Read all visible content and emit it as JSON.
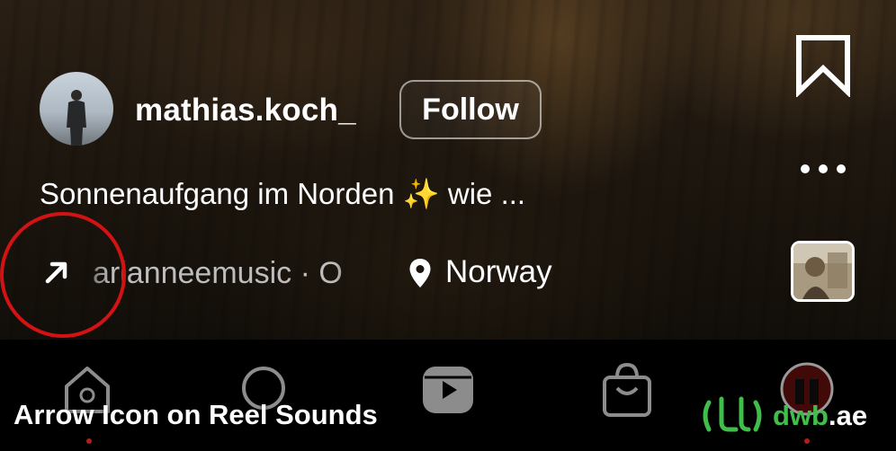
{
  "reel": {
    "username": "mathias.koch_",
    "follow_label": "Follow",
    "caption": "Sonnenaufgang im Norden",
    "caption_sparkle": "✨",
    "caption_suffix": "wie ...",
    "audio_text": "arianneemusic · O",
    "location": "Norway"
  },
  "side_actions": {
    "save_icon": "bookmark-icon",
    "more_icon": "more-horizontal-icon",
    "audio_thumb": "audio-thumbnail"
  },
  "tab_bar": {
    "items": [
      "home-icon",
      "search-icon",
      "reels-icon",
      "shop-icon",
      "profile-icon"
    ]
  },
  "overlay": {
    "title": "Arrow Icon on Reel Sounds",
    "brand_name": "dwb",
    "brand_tld": ".ae",
    "brand_color": "#3fbf4a",
    "highlight_color": "#d31313"
  }
}
